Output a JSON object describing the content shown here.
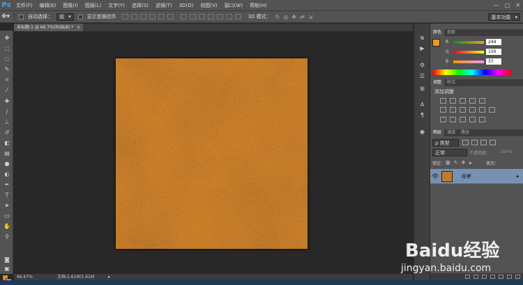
{
  "app": {
    "logo": "Ps"
  },
  "menu": [
    "文件(F)",
    "编辑(E)",
    "图像(I)",
    "图层(L)",
    "文字(Y)",
    "选择(S)",
    "滤镜(T)",
    "3D(D)",
    "视图(V)",
    "窗口(W)",
    "帮助(H)"
  ],
  "window_controls": {
    "minimize": "—",
    "maximize": "▢",
    "close": "✕"
  },
  "options": {
    "auto_select_label": "自动选择：",
    "auto_select_value": "组",
    "show_transform_label": "显示变换控件",
    "mode_3d_label": "3D 模式：",
    "workspace": "基本功能"
  },
  "document": {
    "tab_title": "未标题-1 @ 66.7%(RGB/8) *",
    "close": "×"
  },
  "status": {
    "zoom": "66.67%",
    "doc_info": "文档:1.61M/1.61M"
  },
  "color_panel": {
    "tabs": [
      "颜色",
      "色板"
    ],
    "rows": [
      {
        "label": "R",
        "value": "244"
      },
      {
        "label": "G",
        "value": "150"
      },
      {
        "label": "B",
        "value": "37"
      }
    ],
    "foreground": "#f49625"
  },
  "adjust_panel": {
    "tabs": [
      "调整",
      "样式"
    ],
    "title": "添加调整"
  },
  "layers_panel": {
    "tabs": [
      "图层",
      "通道",
      "路径"
    ],
    "filter_label": "ρ 类型",
    "blend_mode": "正常",
    "opacity_label": "不透明度：",
    "opacity_value": "100%",
    "lock_label": "锁定：",
    "fill_label": "填充：",
    "layer_name": "背景"
  },
  "watermark": {
    "brand": "Baidu经验",
    "url": "jingyan.baidu.com"
  }
}
